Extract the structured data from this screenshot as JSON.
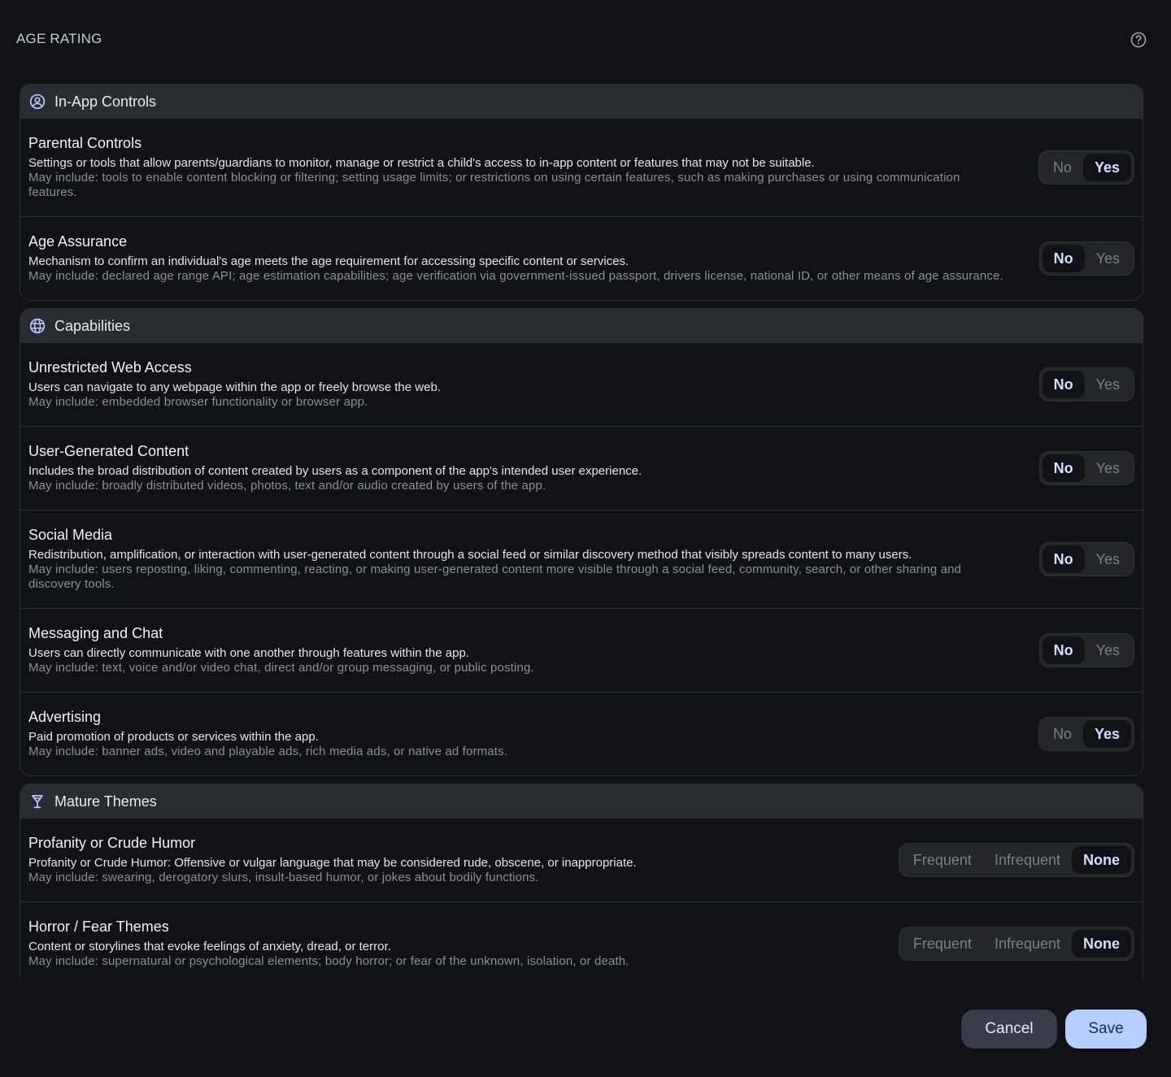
{
  "page": {
    "title": "AGE RATING"
  },
  "sections": [
    {
      "title": "In-App Controls",
      "icon": "user-circle-icon",
      "rows": [
        {
          "title": "Parental Controls",
          "desc": "Settings or tools that allow parents/guardians to monitor, manage or restrict a child's access to in-app content or features that may not be suitable.",
          "hint": "May include: tools to enable content blocking or filtering; setting usage limits; or restrictions on using certain features, such as making purchases or using communication features.",
          "options": [
            "No",
            "Yes"
          ],
          "selected": "Yes"
        },
        {
          "title": "Age Assurance",
          "desc": "Mechanism to confirm an individual's age meets the age requirement for accessing specific content or services.",
          "hint": "May include: declared age range API; age estimation capabilities; age verification via government-issued passport, drivers license, national ID, or other means of age assurance.",
          "options": [
            "No",
            "Yes"
          ],
          "selected": "No"
        }
      ]
    },
    {
      "title": "Capabilities",
      "icon": "globe-icon",
      "rows": [
        {
          "title": "Unrestricted Web Access",
          "desc": "Users can navigate to any webpage within the app or freely browse the web.",
          "hint": "May include: embedded browser functionality or browser app.",
          "options": [
            "No",
            "Yes"
          ],
          "selected": "No"
        },
        {
          "title": "User-Generated Content",
          "desc": "Includes the broad distribution of content created by users as a component of the app's intended user experience.",
          "hint": "May include: broadly distributed videos, photos, text and/or audio created by users of the app.",
          "options": [
            "No",
            "Yes"
          ],
          "selected": "No"
        },
        {
          "title": "Social Media",
          "desc": "Redistribution, amplification, or interaction with user-generated content through a social feed or similar discovery method that visibly spreads content to many users.",
          "hint": "May include: users reposting, liking, commenting, reacting, or making user-generated content more visible through a social feed, community, search, or other sharing and discovery tools.",
          "options": [
            "No",
            "Yes"
          ],
          "selected": "No"
        },
        {
          "title": "Messaging and Chat",
          "desc": "Users can directly communicate with one another through features within the app.",
          "hint": "May include: text, voice and/or video chat, direct and/or group messaging, or public posting.",
          "options": [
            "No",
            "Yes"
          ],
          "selected": "No"
        },
        {
          "title": "Advertising",
          "desc": "Paid promotion of products or services within the app.",
          "hint": "May include: banner ads, video and playable ads, rich media ads, or native ad formats.",
          "options": [
            "No",
            "Yes"
          ],
          "selected": "Yes"
        }
      ]
    },
    {
      "title": "Mature Themes",
      "icon": "cocktail-glass-icon",
      "rows": [
        {
          "title": "Profanity or Crude Humor",
          "desc": "Profanity or Crude Humor: Offensive or vulgar language that may be considered rude, obscene, or inappropriate.",
          "hint": "May include: swearing, derogatory slurs, insult-based humor, or jokes about bodily functions.",
          "options": [
            "Frequent",
            "Infrequent",
            "None"
          ],
          "selected": "None"
        },
        {
          "title": "Horror / Fear Themes",
          "desc": "Content or storylines that evoke feelings of anxiety, dread, or terror.",
          "hint": "May include: supernatural or psychological elements; body horror; or fear of the unknown, isolation, or death.",
          "options": [
            "Frequent",
            "Infrequent",
            "None"
          ],
          "selected": "None"
        }
      ]
    }
  ],
  "footer": {
    "cancel_label": "Cancel",
    "save_label": "Save"
  },
  "colors": {
    "background": "#111217",
    "accent": "#b7ccff",
    "selected_text": "#cfe0ff"
  }
}
